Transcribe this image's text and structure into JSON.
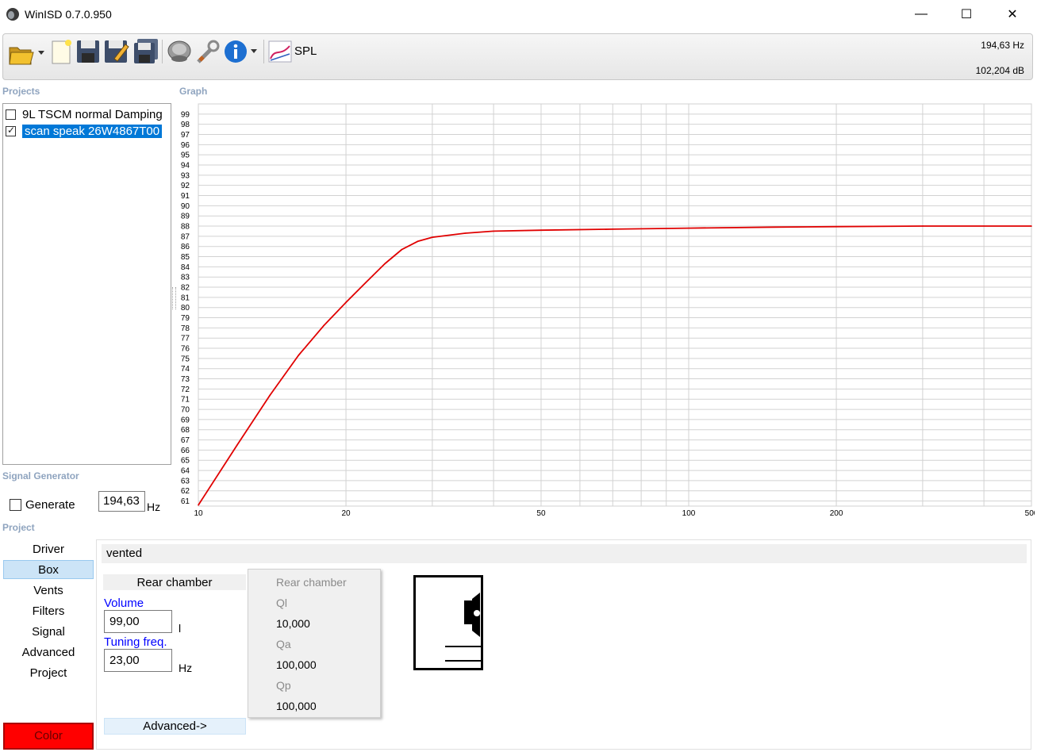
{
  "window": {
    "title": "WinISD 0.7.0.950"
  },
  "toolbar": {
    "spl_label": "SPL",
    "readout_freq": "194,63 Hz",
    "readout_level": "102,204 dB",
    "icons": [
      "open-folder-icon",
      "new-project-icon",
      "save-icon",
      "save-as-icon",
      "save-all-icon",
      "driver-icon",
      "tools-icon",
      "info-icon",
      "spl-graph-icon"
    ]
  },
  "projects": {
    "label": "Projects",
    "items": [
      {
        "name": "9L TSCM normal Damping",
        "checked": false,
        "selected": false
      },
      {
        "name": "scan speak 26W4867T00",
        "checked": true,
        "selected": true
      }
    ]
  },
  "graph": {
    "label": "Graph",
    "line_color": "#e00000"
  },
  "chart_data": {
    "type": "line",
    "title": "",
    "xlabel": "",
    "ylabel": "",
    "x_scale": "log",
    "xlim": [
      10,
      500
    ],
    "ylim": [
      60.5,
      100
    ],
    "x_ticks": [
      "10",
      "20",
      "50",
      "100",
      "200",
      "500"
    ],
    "y_ticks": [
      "61",
      "62",
      "63",
      "64",
      "65",
      "66",
      "67",
      "68",
      "69",
      "70",
      "71",
      "72",
      "73",
      "74",
      "75",
      "76",
      "77",
      "78",
      "79",
      "80",
      "81",
      "82",
      "83",
      "84",
      "85",
      "86",
      "87",
      "88",
      "89",
      "90",
      "91",
      "92",
      "93",
      "94",
      "95",
      "96",
      "97",
      "98",
      "99"
    ],
    "grid": true,
    "series": [
      {
        "x": [
          10,
          12,
          14,
          16,
          18,
          20,
          22,
          24,
          26,
          28,
          30,
          35,
          40,
          50,
          70,
          100,
          150,
          200,
          300,
          500
        ],
        "y": [
          60.6,
          66.5,
          71.4,
          75.3,
          78.2,
          80.5,
          82.5,
          84.3,
          85.7,
          86.5,
          86.9,
          87.3,
          87.5,
          87.6,
          87.7,
          87.8,
          87.9,
          87.95,
          88.0,
          88.0
        ]
      }
    ]
  },
  "signal_generator": {
    "label": "Signal Generator",
    "generate_label": "Generate",
    "generate_checked": false,
    "frequency": "194,63",
    "unit": "Hz"
  },
  "project": {
    "label": "Project",
    "nav": [
      "Driver",
      "Box",
      "Vents",
      "Filters",
      "Signal",
      "Advanced",
      "Project"
    ],
    "active_nav": "Box",
    "color_label": "Color",
    "color_value": "#ff0000"
  },
  "box": {
    "type": "vented",
    "rear_chamber_header": "Rear chamber",
    "volume_label": "Volume",
    "volume_value": "99,00",
    "volume_unit": "l",
    "tuning_label": "Tuning freq.",
    "tuning_value": "23,00",
    "tuning_unit": "Hz",
    "advanced_label": "Advanced->"
  },
  "qpopup": {
    "title": "Rear chamber",
    "ql_label": "Ql",
    "ql_value": "10,000",
    "qa_label": "Qa",
    "qa_value": "100,000",
    "qp_label": "Qp",
    "qp_value": "100,000"
  }
}
